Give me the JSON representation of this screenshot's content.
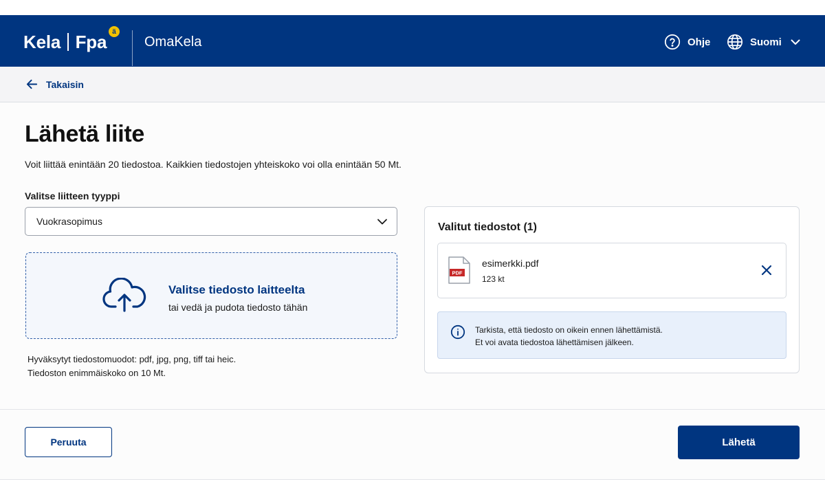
{
  "header": {
    "logo_left": "Kela",
    "logo_right": "Fpa",
    "logo_badge": "ä",
    "app_name": "OmaKela",
    "help_label": "Ohje",
    "language_label": "Suomi"
  },
  "nav": {
    "back_label": "Takaisin"
  },
  "main": {
    "title": "Lähetä liite",
    "subtitle": "Voit liittää enintään 20 tiedostoa. Kaikkien tiedostojen yhteiskoko voi olla enintään 50 Mt.",
    "select": {
      "label": "Valitse liitteen tyyppi",
      "value": "Vuokrasopimus"
    },
    "dropzone": {
      "primary": "Valitse tiedosto laitteelta",
      "secondary": "tai vedä ja pudota tiedosto tähän"
    },
    "hints": [
      "Hyväksytyt tiedostomuodot: pdf, jpg, png, tiff tai heic.",
      "Tiedoston enimmäiskoko on 10 Mt."
    ]
  },
  "selected_files": {
    "title": "Valitut tiedostot (1)",
    "files": [
      {
        "name": "esimerkki.pdf",
        "size": "123 kt",
        "type_badge": "PDF"
      }
    ],
    "notice": [
      "Tarkista, että tiedosto on oikein ennen lähettämistä.",
      "Et voi avata tiedostoa lähettämisen jälkeen."
    ]
  },
  "footer": {
    "cancel_label": "Peruuta",
    "submit_label": "Lähetä"
  },
  "colors": {
    "brand": "#003580",
    "badge": "#f2c200",
    "pdf": "#c62828",
    "notice_bg": "#e8f0fb"
  }
}
